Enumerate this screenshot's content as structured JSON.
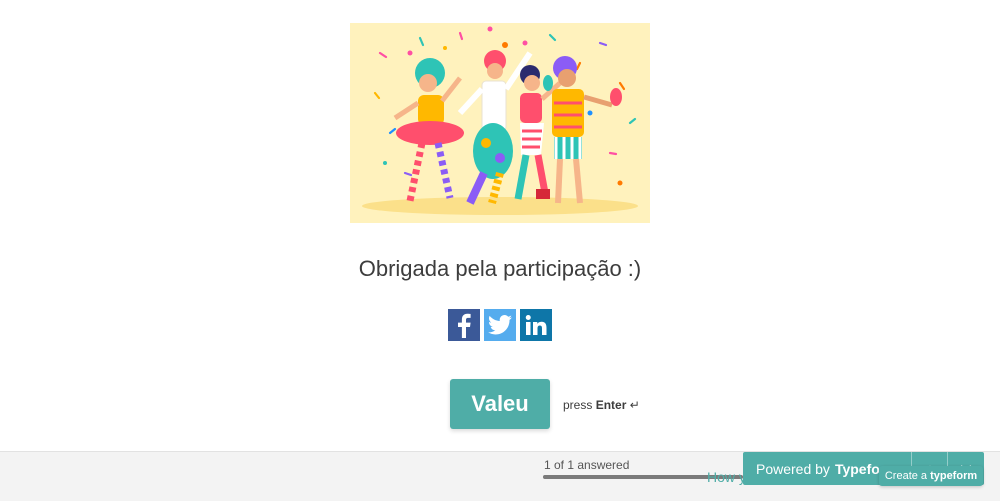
{
  "illustration": {
    "icon": "carnival-dancers-illustration"
  },
  "thank_you": "Obrigada pela participação :)",
  "share": [
    {
      "icon": "facebook-icon"
    },
    {
      "icon": "twitter-icon"
    },
    {
      "icon": "linkedin-icon"
    }
  ],
  "cta": {
    "label": "Valeu",
    "hint_prefix": "press",
    "hint_key": "Enter",
    "hint_symbol": "↵"
  },
  "footer": {
    "progress_text": "1 of 1 answered",
    "progress_fraction": 1.0,
    "partial_link": "How y",
    "powered_prefix": "Powered by",
    "powered_brand": "Typeform",
    "up_icon": "chevron-up-icon",
    "down_icon": "chevron-down-icon",
    "create_prefix": "Create a",
    "create_brand": "typeform"
  },
  "colors": {
    "accent": "#4fada7",
    "illustration_bg": "#fff2bd"
  }
}
